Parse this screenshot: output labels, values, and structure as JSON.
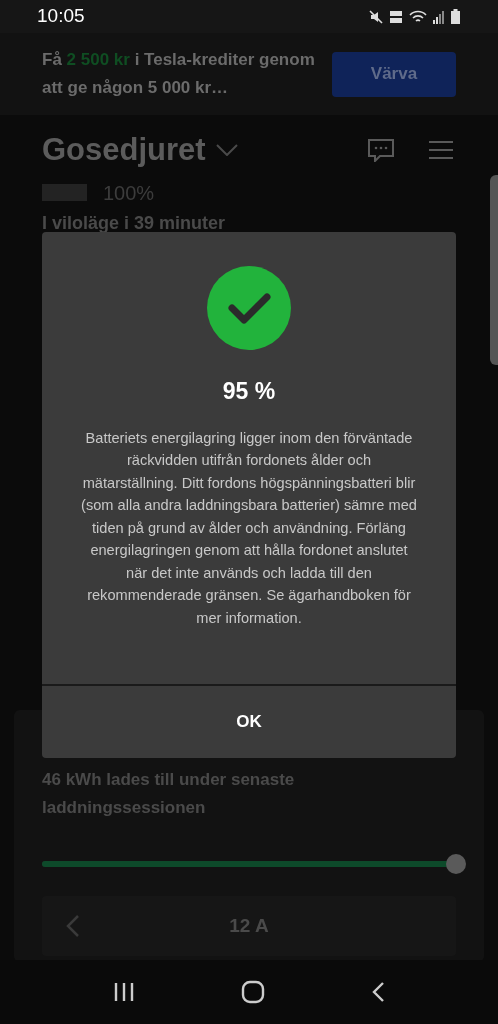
{
  "status_bar": {
    "time": "10:05"
  },
  "banner": {
    "text": "Få **2 500 kr** i Tesla-krediter genom att ge någon 5 000 kr…",
    "button": "Värva"
  },
  "vehicle": {
    "name": "Gosedjuret",
    "battery": {
      "level": 1,
      "reading": "100%"
    },
    "state": "I viloläge i 39 minuter"
  },
  "charging": {
    "energy_text": "46 kWh lades till under senaste laddningssessionen",
    "slider": {
      "level": 1
    },
    "current": "12 A"
  },
  "dialog": {
    "title": "95 %",
    "message": "Batteriets energilagring ligger inom den förväntade räckvidden utifrån fordonets ålder och mätarställning. Ditt fordons högspänningsbatteri blir (som alla andra laddningsbara batterier) sämre med tiden på grund av ålder och användning. Förläng energilagringen genom att hålla fordonet anslutet när det inte används och ladda till den rekommenderade gränsen. Se ägarhandboken för mer information.",
    "button": "OK"
  }
}
